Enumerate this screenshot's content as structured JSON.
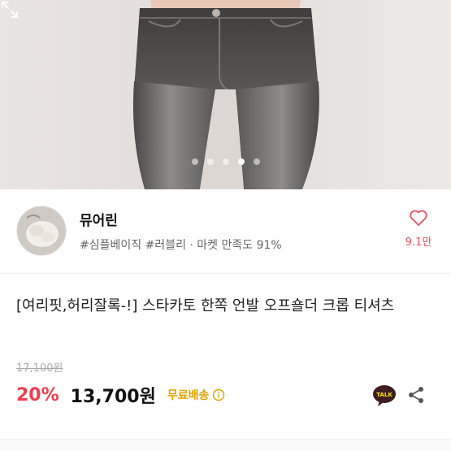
{
  "product_image": {
    "carousel_count": 5,
    "carousel_active_index": 3
  },
  "icons": {
    "expand": "expand-icon",
    "like": "heart-outline-icon",
    "info": "info-circle-icon",
    "kakaotalk": "kakaotalk-icon",
    "share": "share-icon"
  },
  "shop": {
    "name": "뮤어린",
    "tags": "#심플베이직 #러블리 · 마켓 만족도 91%",
    "like_count": "9.1만"
  },
  "product": {
    "title": "[여리핏,허리잘록-!] 스타카토 한쪽 언발 오프숄더 크롭 티셔츠",
    "original_price": "17,100원",
    "discount": "20%",
    "price": "13,700원",
    "shipping": "무료배송",
    "talk_label": "TALK"
  },
  "colors": {
    "discount": "#ef3e4e",
    "like": "#ef4f62",
    "shipping": "#e0a100"
  }
}
